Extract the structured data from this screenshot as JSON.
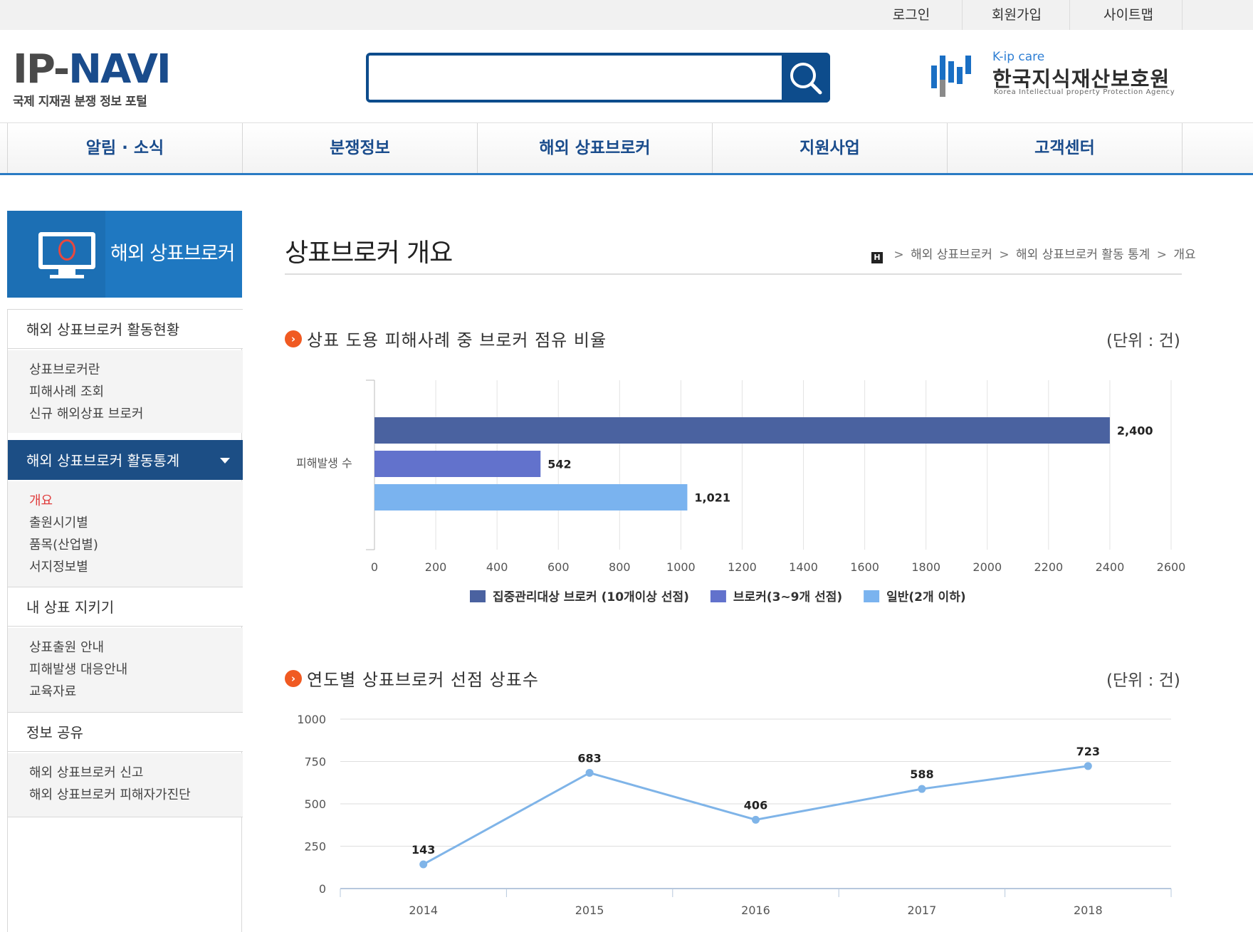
{
  "utility": {
    "login": "로그인",
    "join": "회원가입",
    "sitemap": "사이트맵"
  },
  "logo": {
    "ip": "IP",
    "navi": "NAVI",
    "subtitle": "국제 지재권 분쟁 정보 포털"
  },
  "search": {
    "value": "",
    "placeholder": ""
  },
  "agency": {
    "kip": "K-ip care",
    "name": "한국지식재산보호원",
    "eng": "Korea Intellectual property Protection Agency"
  },
  "gnb": [
    "알림 · 소식",
    "분쟁정보",
    "해외 상표브로커",
    "지원사업",
    "고객센터"
  ],
  "lnb": {
    "title": "해외 상표브로커",
    "groups": [
      {
        "label": "해외 상표브로커 활동현황",
        "items": [
          "상표브로커란",
          "피해사례 조회",
          "신규 해외상표 브로커"
        ]
      },
      {
        "label": "해외 상표브로커 활동통계",
        "items": [
          "개요",
          "출원시기별",
          "품목(산업별)",
          "서지정보별"
        ]
      },
      {
        "label": "내 상표 지키기",
        "items": [
          "상표출원 안내",
          "피해발생 대응안내",
          "교육자료"
        ]
      },
      {
        "label": "정보 공유",
        "items": [
          "해외 상표브로커 신고",
          "해외 상표브로커 피해자가진단"
        ]
      }
    ],
    "active_item": "개요"
  },
  "page": {
    "title": "상표브로커 개요",
    "breadcrumb": [
      "해외 상표브로커",
      "해외 상표브로커 활동 통계",
      "개요"
    ],
    "home_label": "H"
  },
  "sections": [
    {
      "title": "상표 도용 피해사례 중 브로커 점유 비율",
      "unit": "(단위 : 건)"
    },
    {
      "title": "연도별 상표브로커 선점 상표수",
      "unit": "(단위 : 건)"
    }
  ],
  "colors": {
    "navy": "#4a62a0",
    "mid": "#6272cc",
    "light": "#7ab3ef",
    "line": "#7fb4e8",
    "accent": "#f05a22",
    "brand": "#0d4c8c"
  },
  "chart_data": [
    {
      "type": "bar",
      "orientation": "horizontal",
      "categories": [
        "피해발생 수"
      ],
      "series": [
        {
          "name": "집중관리대상 브로커 (10개이상 선점)",
          "values": [
            2400
          ],
          "labels": [
            "2,400"
          ],
          "color": "#4a62a0"
        },
        {
          "name": "브로커(3~9개 선점)",
          "values": [
            542
          ],
          "labels": [
            "542"
          ],
          "color": "#6272cc"
        },
        {
          "name": "일반(2개 이하)",
          "values": [
            1021
          ],
          "labels": [
            "1,021"
          ],
          "color": "#7ab3ef"
        }
      ],
      "xlim": [
        0,
        2600
      ],
      "xticks": [
        0,
        200,
        400,
        600,
        800,
        1000,
        1200,
        1400,
        1600,
        1800,
        2000,
        2200,
        2400,
        2600
      ],
      "grid": true,
      "legend": "bottom-center"
    },
    {
      "type": "line",
      "categories": [
        "2014",
        "2015",
        "2016",
        "2017",
        "2018"
      ],
      "series": [
        {
          "values": [
            143,
            683,
            406,
            588,
            723
          ],
          "color": "#7fb4e8"
        }
      ],
      "ylim": [
        0,
        1000
      ],
      "yticks": [
        0,
        250,
        500,
        750,
        1000
      ],
      "grid": true,
      "legend": "none"
    }
  ]
}
